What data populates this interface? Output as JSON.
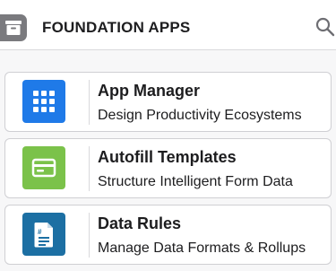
{
  "header": {
    "title": "FOUNDATION APPS",
    "icon": "archive-box-icon",
    "search_icon": "search-icon"
  },
  "apps": [
    {
      "title": "App Manager",
      "description": "Design Productivity Ecosystems",
      "icon": "grid-apps-icon",
      "color": "#1f7ae8"
    },
    {
      "title": "Autofill Templates",
      "description": "Structure Intelligent Form Data",
      "icon": "form-card-icon",
      "color": "#7bc24a"
    },
    {
      "title": "Data Rules",
      "description": "Manage Data Formats & Rollups",
      "icon": "document-rules-icon",
      "color": "#1c6fa3"
    }
  ],
  "colors": {
    "header_icon_bg": "#7a7a7e",
    "card_border": "#cfcfd3"
  }
}
